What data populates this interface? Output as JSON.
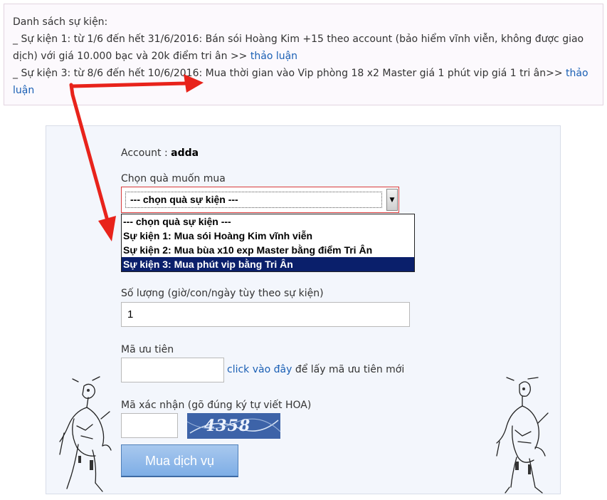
{
  "notice": {
    "heading": "Danh sách sự kiện:",
    "event1_text": "_ Sự kiện 1: từ 1/6 đến hết 31/6/2016: Bán sói Hoàng Kim +15 theo account (bảo hiểm vĩnh viễn, không được giao dịch) với giá 10.000 bạc và 20k điểm tri ân >> ",
    "event3_text": "_ Sự kiện 3: từ 8/6 đến hết 10/6/2016: Mua thời gian vào Vip phòng 18 x2 Master giá 1 phút vip giá 1 tri ân>> ",
    "discuss_link": "thảo luận"
  },
  "form": {
    "account_label": "Account : ",
    "account_value": "adda",
    "gift_label": "Chọn quà muốn mua",
    "gift_selected": "--- chọn quà sự kiện ---",
    "gift_options": [
      "--- chọn quà sự kiện ---",
      "Sự kiện 1: Mua sói Hoàng Kim vĩnh viễn",
      "Sự kiện 2: Mua bùa x10 exp Master bằng điểm Tri Ân",
      "Sự kiện 3: Mua phút vip bằng Tri Ân"
    ],
    "highlighted_option_index": 3,
    "quantity_label": "Số lượng (giờ/con/ngày tùy theo sự kiện)",
    "quantity_value": "1",
    "priority_label": "Mã ưu tiên",
    "priority_value": "",
    "priority_link": "click vào đây",
    "priority_suffix": " để lấy mã ưu tiên mới",
    "captcha_label": "Mã xác nhận (gõ đúng ký tự viết HOA)",
    "captcha_value": "",
    "captcha_text": "4358",
    "submit_label": "Mua dịch vụ"
  },
  "colors": {
    "link": "#1a5fb4",
    "annotation_arrow": "#e8231b",
    "dropdown_highlight": "#0a1f6b",
    "button": "#7eaee6"
  }
}
